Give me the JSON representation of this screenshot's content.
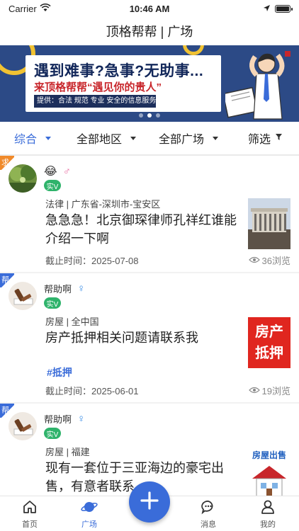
{
  "status_bar": {
    "carrier": "Carrier",
    "time": "10:46 AM"
  },
  "navbar": {
    "title": "顶格帮帮 | 广场"
  },
  "banner": {
    "headline": "遇到难事?急事?无助事...",
    "subline": "来顶格帮帮“遇见你的贵人”",
    "tagline": "提供：合法  规范  专业  安全的信息服务",
    "slide_count": 3,
    "active_slide": 2
  },
  "filters": {
    "items": [
      {
        "label": "综合",
        "active": true
      },
      {
        "label": "全部地区",
        "active": false
      },
      {
        "label": "全部广场",
        "active": false
      },
      {
        "label": "筛选",
        "active": false
      }
    ]
  },
  "posts": [
    {
      "ribbon": "求",
      "ribbon_color": "#f08a2a",
      "user_name": "😂",
      "gender_symbol": "♂",
      "gender_color": "#e86ba0",
      "badge": "实V",
      "category": "法律 | 广东省-深圳市-宝安区",
      "title": "急急急！北京御琛律师孔祥红谁能介绍一下啊",
      "tag": "",
      "deadline": "截止时间：2025-07-08",
      "views": "36浏览"
    },
    {
      "ribbon": "帮",
      "ribbon_color": "#3a6cd9",
      "user_name": "帮助啊",
      "gender_symbol": "♀",
      "gender_color": "#3a8ee6",
      "badge": "实V",
      "category": "房屋 | 全中国",
      "title": "房产抵押相关问题请联系我",
      "tag": "#抵押",
      "deadline": "截止时间：2025-06-01",
      "views": "19浏览",
      "thumb_text_1": "房产",
      "thumb_text_2": "抵押"
    },
    {
      "ribbon": "帮",
      "ribbon_color": "#3a6cd9",
      "user_name": "帮助啊",
      "gender_symbol": "♀",
      "gender_color": "#3a8ee6",
      "badge": "实V",
      "category": "房屋 | 福建",
      "title": "现有一套位于三亚海边的豪宅出售，有意者联系",
      "thumb_text_1": "房屋出售"
    }
  ],
  "tabbar": {
    "items": [
      {
        "label": "首页",
        "icon": "home-icon",
        "active": false
      },
      {
        "label": "广场",
        "icon": "planet-icon",
        "active": true
      },
      {
        "label": "消息",
        "icon": "message-icon",
        "active": false
      },
      {
        "label": "我的",
        "icon": "profile-icon",
        "active": false
      }
    ]
  },
  "colors": {
    "accent": "#3a6cd9",
    "verified": "#2fb36b",
    "seek_ribbon": "#f08a2a"
  }
}
